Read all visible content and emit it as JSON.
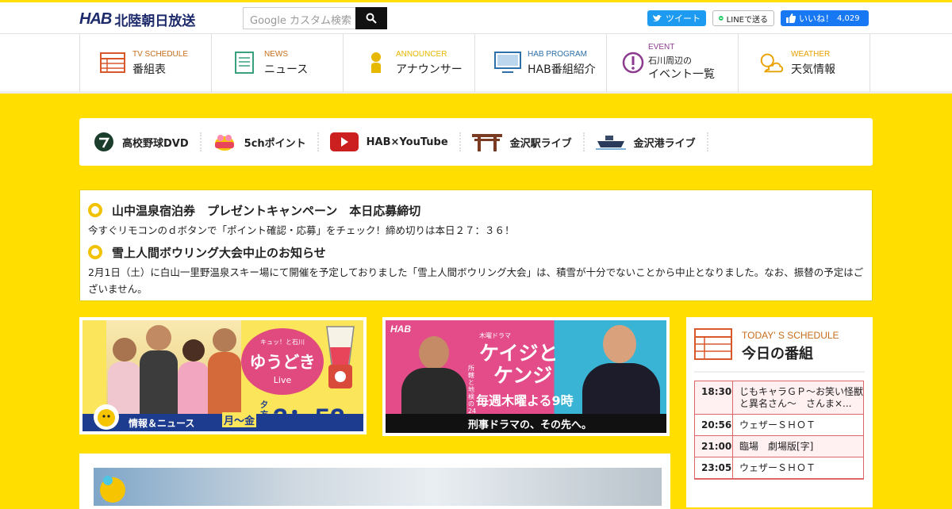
{
  "header": {
    "logo_text": "HAB",
    "station_name": "北陸朝日放送",
    "search_placeholder": "Google カスタム検索",
    "tweet_label": "ツイート",
    "line_label": "LINEで送る",
    "like_label": "いいね！",
    "like_count": "4,029"
  },
  "nav": [
    {
      "en": "TV SCHEDULE",
      "ja": "番組表",
      "icon": "tv-schedule-icon"
    },
    {
      "en": "NEWS",
      "ja": "ニュース",
      "icon": "news-icon"
    },
    {
      "en": "ANNOUNCER",
      "ja": "アナウンサー",
      "icon": "announcer-icon"
    },
    {
      "en": "HAB PROGRAM",
      "ja": "HAB番組紹介",
      "icon": "monitor-icon"
    },
    {
      "en": "EVENT",
      "sub": "石川周辺の",
      "ja": "イベント一覧",
      "icon": "exclamation-icon"
    },
    {
      "en": "WEATHER",
      "ja": "天気情報",
      "icon": "weather-icon"
    }
  ],
  "quick_links": [
    {
      "label": "高校野球DVD",
      "icon": "baseball-icon"
    },
    {
      "label": "5chポイント",
      "icon": "point-mascot-icon"
    },
    {
      "label": "HAB×YouTube",
      "icon": "youtube-icon"
    },
    {
      "label": "金沢駅ライブ",
      "icon": "torii-gate-icon"
    },
    {
      "label": "金沢港ライブ",
      "icon": "ship-icon"
    }
  ],
  "notices": [
    {
      "title": "山中温泉宿泊券　プレゼントキャンペーン　本日応募締切",
      "body": "今すぐリモコンのｄボタンで「ポイント確認・応募」をチェック！締め切りは本日２７：３６！"
    },
    {
      "title": "雪上人間ボウリング大会中止のお知らせ",
      "body": "2月1日（土）に白山一里野温泉スキー場にて開催を予定しておりました「雪上人間ボウリング大会」は、積雪が十分でないことから中止となりました。なお、振替の予定はございません。"
    }
  ],
  "banner_yudoki": {
    "tagline": "キュッ！と石川",
    "title": "ゆうどき",
    "live": "Live",
    "footer": "情報＆ニュース",
    "days": "月～金",
    "evening": "夕方",
    "time": "3：52"
  },
  "banner_keiji": {
    "hab": "HAB",
    "drama_tag": "木曜ドラマ",
    "title_a": "ケイジと",
    "title_b": "ケンジ",
    "subtitle": "所轄と地検の24時",
    "schedule": "毎週木曜よる9時",
    "footer": "刑事ドラマの、その先へ。"
  },
  "schedule": {
    "en": "TODAY' S SCHEDULE",
    "ja": "今日の番組",
    "rows": [
      {
        "time": "18:30",
        "program": "じもキャラＧＰ～お笑い怪獣と異名さん～　さんま×...",
        "highlight": true
      },
      {
        "time": "20:56",
        "program": "ウェザーＳＨＯＴ",
        "highlight": false
      },
      {
        "time": "21:00",
        "program": "臨場　劇場版[字]",
        "highlight": true
      },
      {
        "time": "23:05",
        "program": "ウェザーＳＨＯＴ",
        "highlight": false
      }
    ]
  },
  "colors": {
    "brand_yellow": "#FFDE00",
    "navy": "#1d2a6b",
    "accent_orange": "#c76c1a",
    "schedule_red": "#d66"
  }
}
